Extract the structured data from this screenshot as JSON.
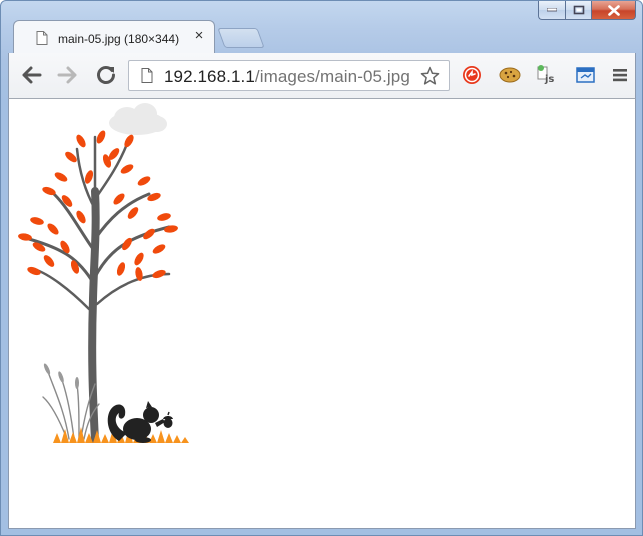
{
  "window": {
    "caption_buttons": [
      "minimize",
      "maximize",
      "close"
    ]
  },
  "tab": {
    "title": "main-05.jpg (180×344)",
    "favicon": "page-icon",
    "close_glyph": "×"
  },
  "toolbar": {
    "url_host": "192.168.1.1",
    "url_path": "/images/main-05.jpg",
    "icons": [
      "back-arrow-icon",
      "forward-arrow-icon",
      "reload-icon",
      "star-icon",
      "menu-icon"
    ],
    "extensions": [
      "red-circle-extension-icon",
      "cookie-extension-icon",
      "js-extension-icon",
      "window-extension-icon"
    ]
  },
  "content": {
    "image_title": "main-05.jpg",
    "image_size": "180×344",
    "colors": {
      "leaf": "#f04a0c",
      "trunk": "#5d5d5d",
      "grass": "#f7931e",
      "squirrel": "#222222",
      "cloud": "#eaeaea"
    }
  }
}
